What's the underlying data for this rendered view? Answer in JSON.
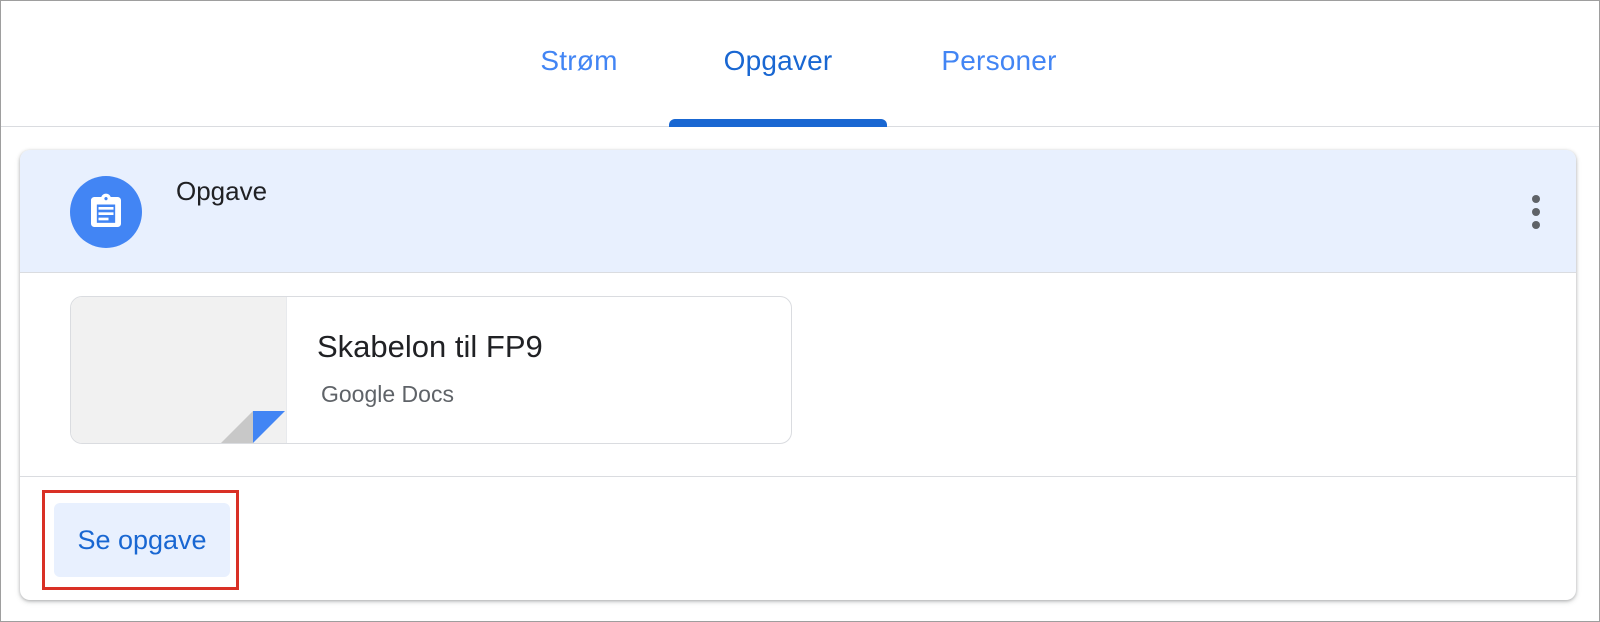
{
  "tabs": [
    {
      "label": "Strøm",
      "active": false
    },
    {
      "label": "Opgaver",
      "active": true
    },
    {
      "label": "Personer",
      "active": false
    }
  ],
  "card": {
    "title": "Opgave",
    "icon": "assignment-clipboard-icon",
    "menu_icon": "more-vert-icon",
    "attachment": {
      "title": "Skabelon til FP9",
      "subtitle": "Google Docs"
    },
    "action_label": "Se opgave"
  },
  "colors": {
    "accent": "#1967d2",
    "tab_inactive": "#4285f4",
    "header_bg": "#e8f0fe",
    "highlight": "#d93025"
  }
}
